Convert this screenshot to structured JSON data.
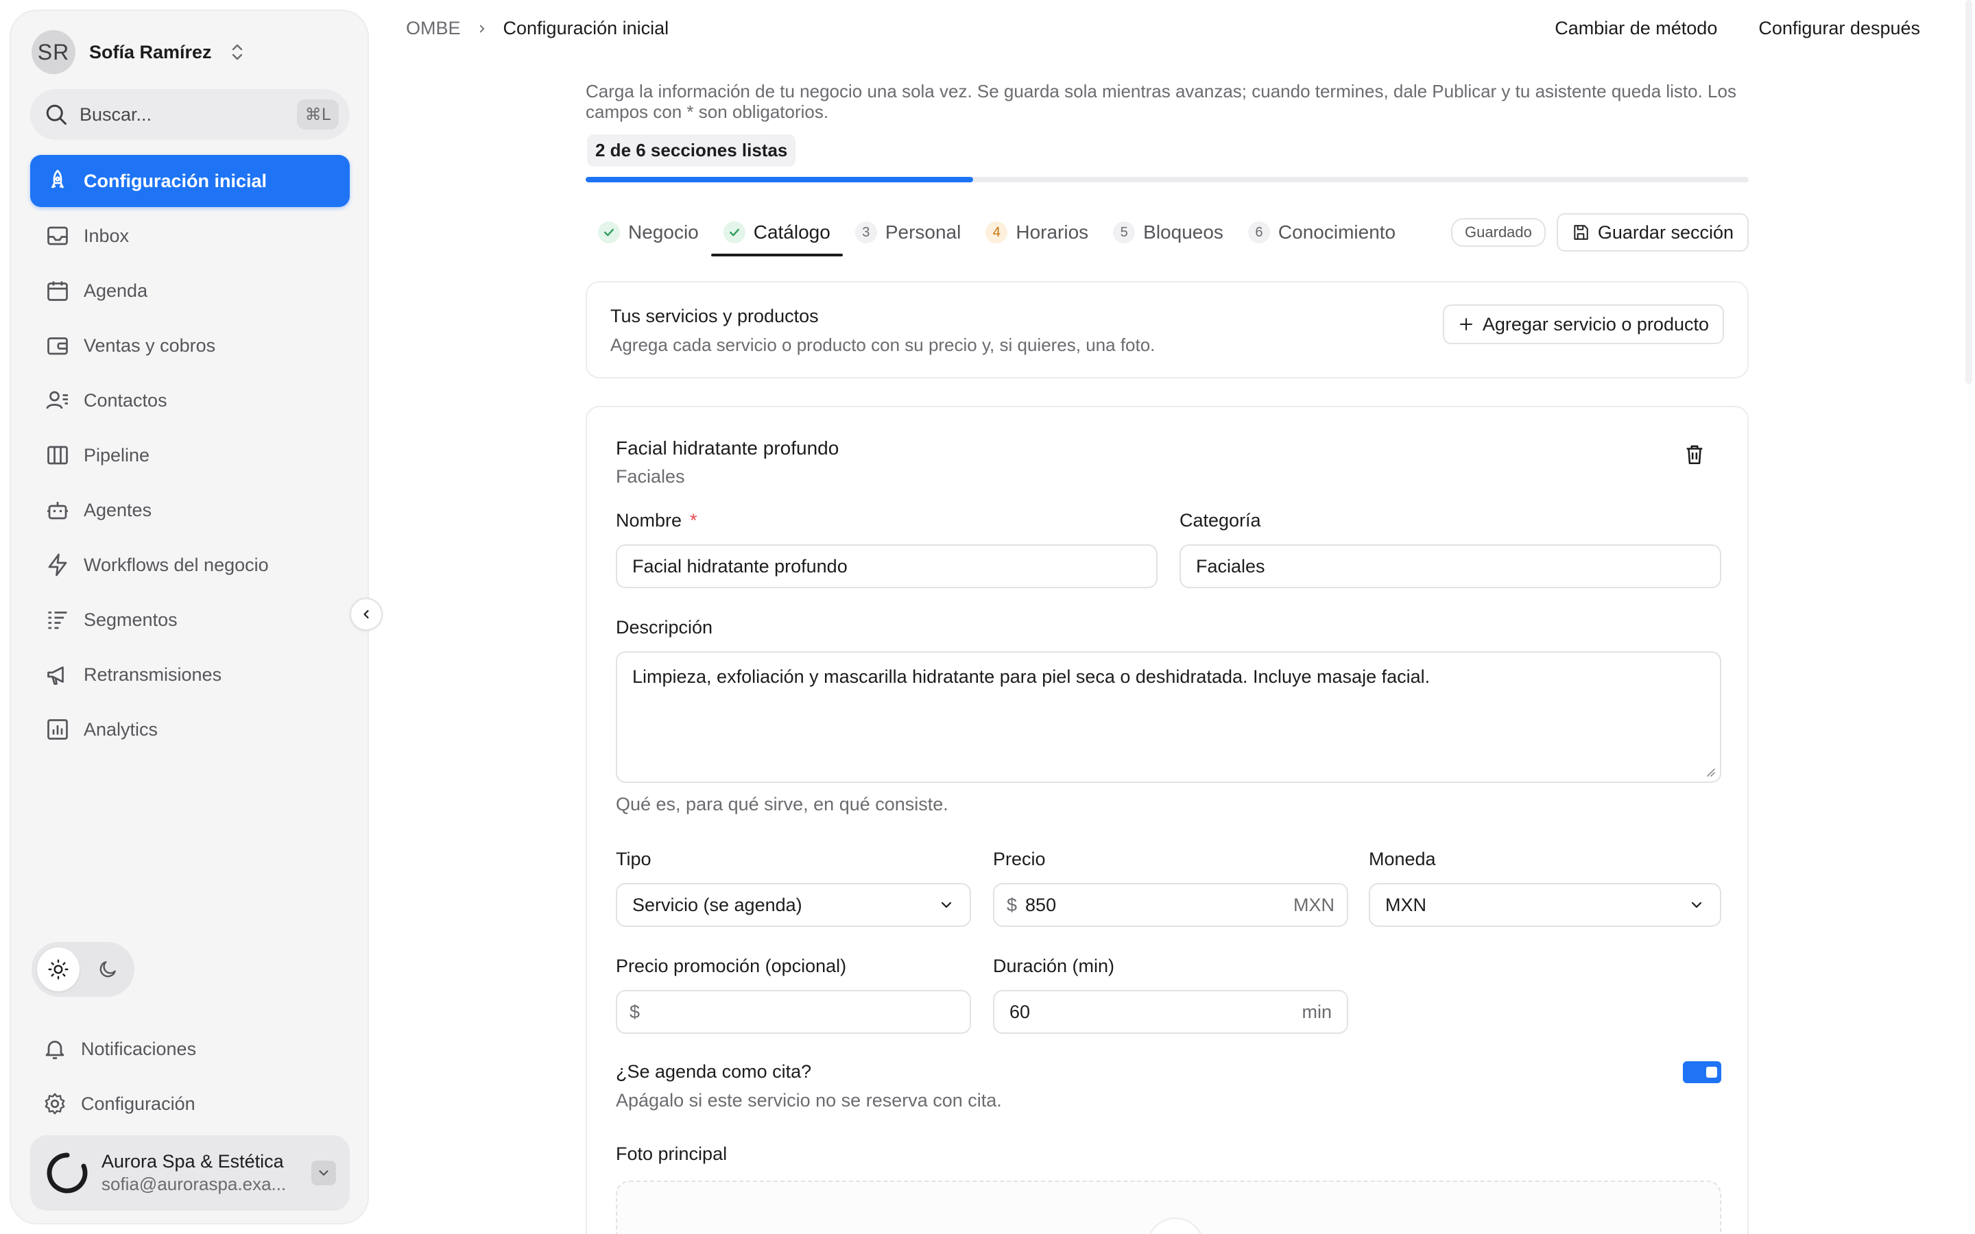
{
  "user": {
    "initials": "SR",
    "name": "Sofía Ramírez"
  },
  "search": {
    "placeholder": "Buscar...",
    "shortcut": "⌘L"
  },
  "nav": [
    {
      "label": "Configuración inicial",
      "icon": "rocket-icon",
      "active": true
    },
    {
      "label": "Inbox",
      "icon": "inbox-icon"
    },
    {
      "label": "Agenda",
      "icon": "calendar-icon"
    },
    {
      "label": "Ventas y cobros",
      "icon": "wallet-icon"
    },
    {
      "label": "Contactos",
      "icon": "contacts-icon"
    },
    {
      "label": "Pipeline",
      "icon": "columns-icon"
    },
    {
      "label": "Agentes",
      "icon": "bot-icon"
    },
    {
      "label": "Workflows del negocio",
      "icon": "bolt-icon"
    },
    {
      "label": "Segmentos",
      "icon": "list-filter-icon"
    },
    {
      "label": "Retransmisiones",
      "icon": "megaphone-icon"
    },
    {
      "label": "Analytics",
      "icon": "bar-chart-icon"
    }
  ],
  "bottom_links": [
    {
      "label": "Notificaciones",
      "icon": "bell-icon"
    },
    {
      "label": "Configuración",
      "icon": "gear-icon"
    }
  ],
  "org": {
    "name": "Aurora Spa & Estética",
    "email": "sofia@auroraspa.exa..."
  },
  "breadcrumb": {
    "root": "OMBE",
    "current": "Configuración inicial"
  },
  "top_actions": {
    "change_method": "Cambiar de método",
    "configure_later": "Configurar después"
  },
  "intro": "Carga la información de tu negocio una sola vez. Se guarda sola mientras avanzas; cuando termines, dale Publicar y tu asistente queda listo. Los campos con * son obligatorios.",
  "progress": {
    "label": "2 de 6 secciones listas",
    "done": 2,
    "total": 6
  },
  "tabs": [
    {
      "badge": "✓",
      "label": "Negocio",
      "state": "done"
    },
    {
      "badge": "✓",
      "label": "Catálogo",
      "state": "done",
      "active": true
    },
    {
      "badge": "3",
      "label": "Personal",
      "state": "pending"
    },
    {
      "badge": "4",
      "label": "Horarios",
      "state": "warn"
    },
    {
      "badge": "5",
      "label": "Bloqueos",
      "state": "pending"
    },
    {
      "badge": "6",
      "label": "Conocimiento",
      "state": "pending"
    }
  ],
  "saved_status": "Guardado",
  "save_section": "Guardar sección",
  "services_card": {
    "title": "Tus servicios y productos",
    "subtitle": "Agrega cada servicio o producto con su precio y, si quieres, una foto.",
    "add_button": "Agregar servicio o producto"
  },
  "item": {
    "title": "Facial hidratante profundo",
    "category_caption": "Faciales",
    "name_label": "Nombre",
    "required_mark": "*",
    "name_value": "Facial hidratante profundo",
    "category_label": "Categoría",
    "category_value": "Faciales",
    "description_label": "Descripción",
    "description_value": "Limpieza, exfoliación y mascarilla hidratante para piel seca o deshidratada. Incluye masaje facial.",
    "description_hint": "Qué es, para qué sirve, en qué consiste.",
    "type_label": "Tipo",
    "type_value": "Servicio (se agenda)",
    "price_label": "Precio",
    "price_prefix": "$",
    "price_value": "850",
    "price_suffix": "MXN",
    "currency_label": "Moneda",
    "currency_value": "MXN",
    "promo_label": "Precio promoción (opcional)",
    "promo_prefix": "$",
    "duration_label": "Duración (min)",
    "duration_value": "60",
    "duration_suffix": "min",
    "bookable_label": "¿Se agenda como cita?",
    "bookable_hint": "Apágalo si este servicio no se reserva con cita.",
    "bookable_on": true,
    "photo_label": "Foto principal"
  },
  "colors": {
    "accent": "#1e74f5",
    "required": "#e5484d",
    "done": "#2f9e5a",
    "warn": "#c4730f"
  }
}
